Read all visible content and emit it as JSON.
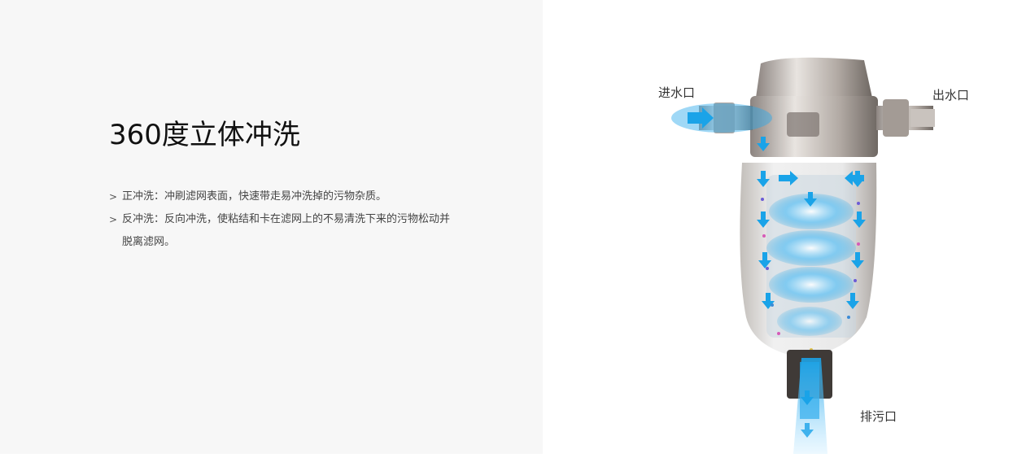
{
  "title": "360度立体冲洗",
  "features": [
    {
      "text": "正冲洗：冲刷滤网表面，快速带走易冲洗掉的污物杂质。"
    },
    {
      "text": "反冲洗：反向冲洗，使粘结和卡在滤网上的不易清洗下来的污物松动并脱离滤网。"
    }
  ],
  "product_labels": {
    "inlet": "进水口",
    "outlet": "出水口",
    "drain": "排污口"
  },
  "colors": {
    "left_bg": "#f7f7f7",
    "water_blue": "#1aa3e8",
    "title": "#111111"
  },
  "icons": [
    "chevron-right-icon"
  ]
}
